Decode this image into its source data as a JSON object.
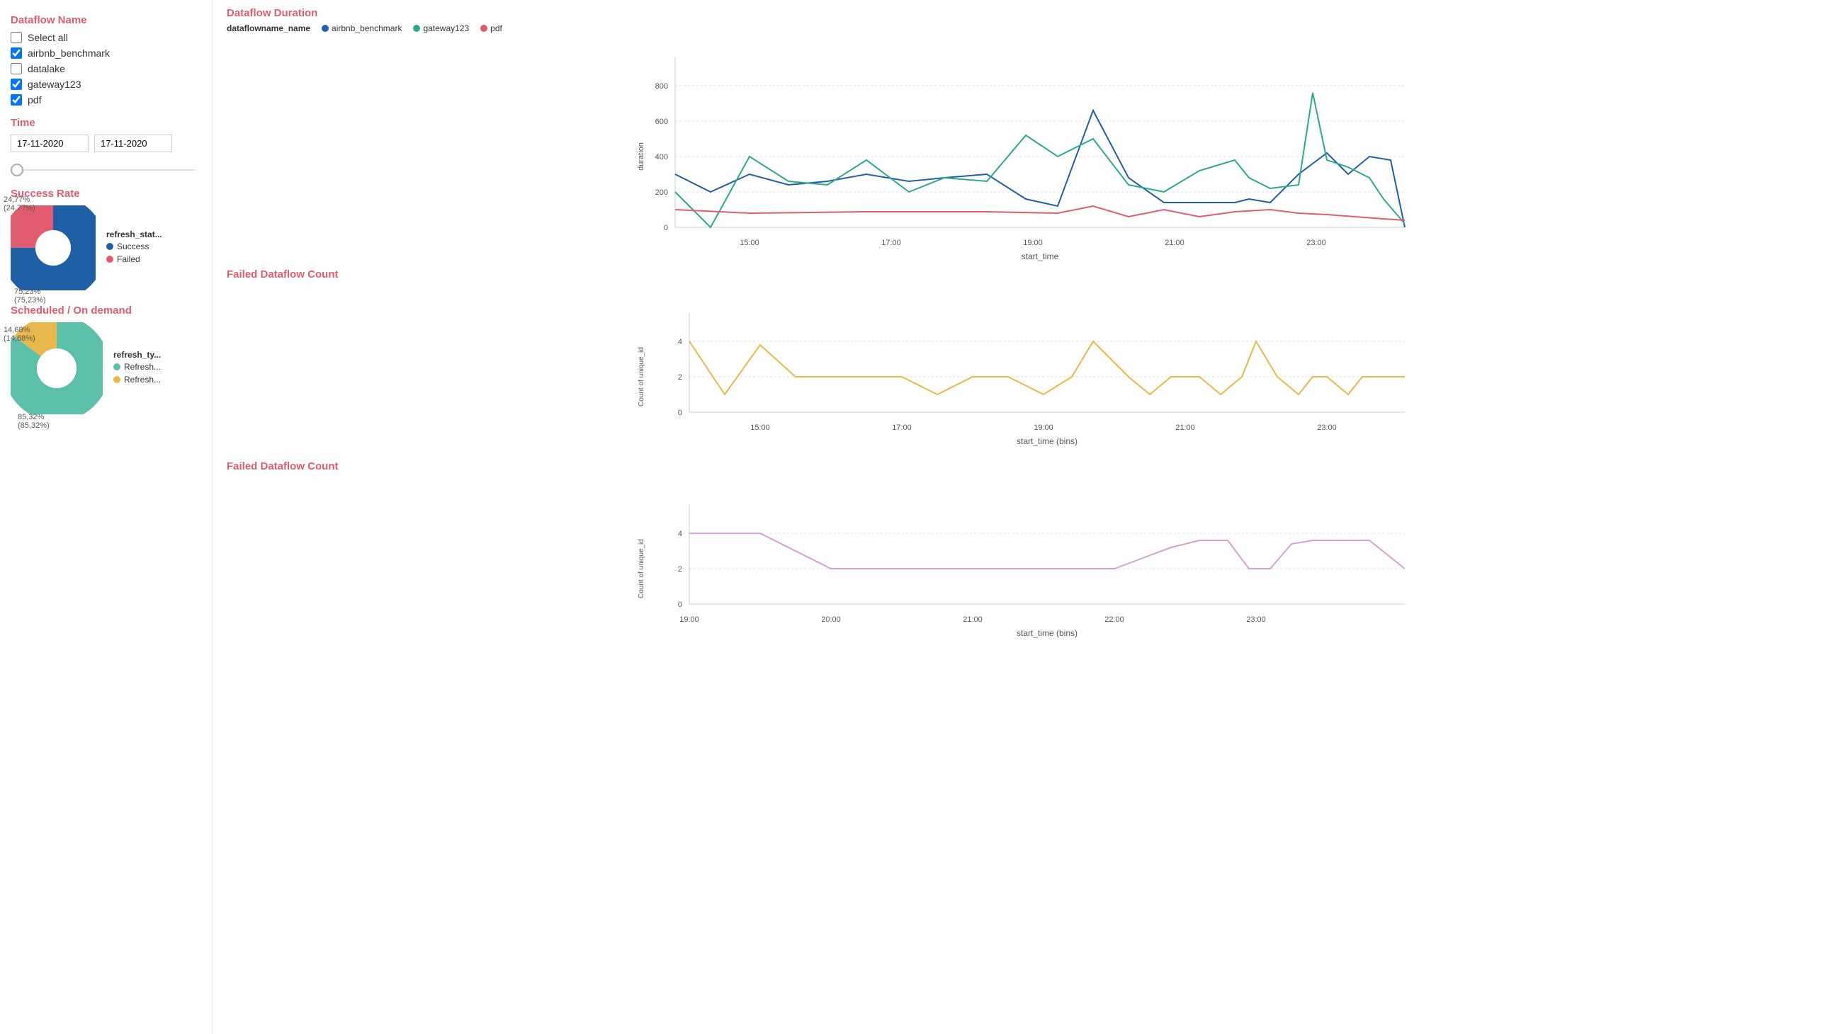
{
  "sidebar": {
    "dataflow_title": "Dataflow Name",
    "select_all_label": "Select all",
    "items": [
      {
        "label": "airbnb_benchmark",
        "checked": true
      },
      {
        "label": "datalake",
        "checked": false
      },
      {
        "label": "gateway123",
        "checked": true
      },
      {
        "label": "pdf",
        "checked": true
      }
    ],
    "time_title": "Time",
    "date_start": "17-11-2020",
    "date_end": "17-11-2020"
  },
  "duration_chart": {
    "title": "Dataflow Duration",
    "legend_label": "dataflowname_name",
    "legend_items": [
      {
        "label": "airbnb_benchmark",
        "color": "#1f5fa6"
      },
      {
        "label": "gateway123",
        "color": "#2aaa8a"
      },
      {
        "label": "pdf",
        "color": "#e05c6e"
      }
    ],
    "y_label": "duration",
    "x_label": "start_time",
    "y_ticks": [
      0,
      200,
      400,
      600,
      800
    ],
    "x_ticks": [
      "15:00",
      "17:00",
      "19:00",
      "21:00",
      "23:00"
    ]
  },
  "failed_count_chart": {
    "title": "Failed Dataflow Count",
    "y_label": "Count of unique_id",
    "x_label": "start_time (bins)",
    "y_ticks": [
      0,
      2,
      4
    ],
    "x_ticks": [
      "15:00",
      "17:00",
      "19:00",
      "21:00",
      "23:00"
    ],
    "color": "#e8b84b"
  },
  "failed_count_chart2": {
    "title": "Failed Dataflow Count",
    "y_label": "Count of unique_id",
    "x_label": "start_time (bins)",
    "y_ticks": [
      0,
      2,
      4
    ],
    "x_ticks": [
      "19:00",
      "20:00",
      "21:00",
      "22:00",
      "23:00"
    ],
    "color": "#d4a0d0"
  },
  "success_rate": {
    "title": "Success Rate",
    "legend_title": "refresh_stat...",
    "segments": [
      {
        "label": "Success",
        "color": "#1f5fa6",
        "percent": 75.23,
        "display": "75,23%\n(75,23%)"
      },
      {
        "label": "Failed",
        "color": "#e05c6e",
        "percent": 24.77,
        "display": "24,77%\n(24,77%)"
      }
    ]
  },
  "scheduled": {
    "title": "Scheduled / On demand",
    "legend_title": "refresh_ty...",
    "segments": [
      {
        "label": "Refresh...",
        "color": "#5bbfaa",
        "percent": 85.32,
        "display": "85,32%\n(85,32%)"
      },
      {
        "label": "Refresh...",
        "color": "#e8b84b",
        "percent": 14.68,
        "display": "14,68%\n(14,68%)"
      }
    ]
  }
}
